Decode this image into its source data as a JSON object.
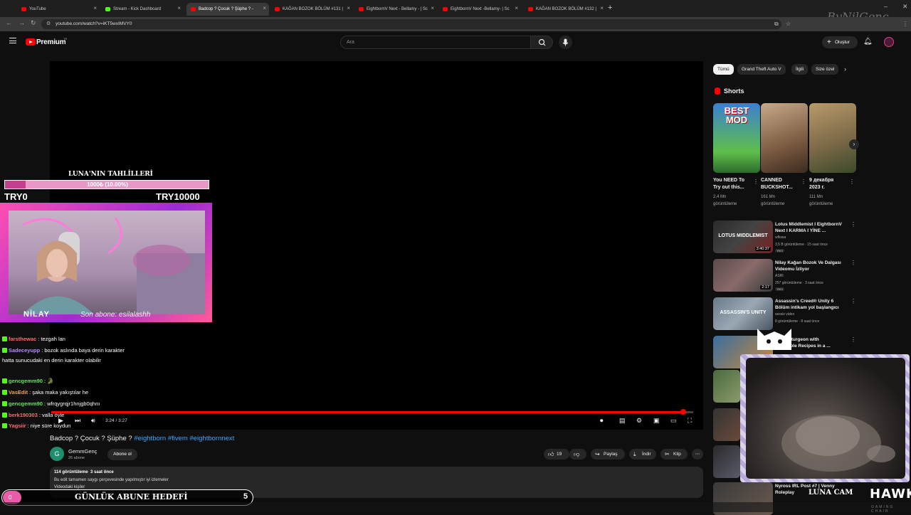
{
  "browser": {
    "tabs": [
      {
        "label": "YouTube",
        "color": "#ff0000",
        "active": false
      },
      {
        "label": "Stream - Kick Dashboard",
        "color": "#53fc18",
        "active": false
      },
      {
        "label": "Badcop ? Çocuk ? Şüphe ? -",
        "color": "#ff0000",
        "active": true
      },
      {
        "label": "KAĞAN BOZOK BÖLÜM #131 |",
        "color": "#ff0000",
        "active": false
      },
      {
        "label": "EightbornV Next - Bellamy - | Sc",
        "color": "#ff0000",
        "active": false
      },
      {
        "label": "EightbornV Next -Bellamy- | Sc",
        "color": "#ff0000",
        "active": false
      },
      {
        "label": "KAĞAN BOZOK BÖLÜM #132 |",
        "color": "#ff0000",
        "active": false
      }
    ],
    "url": "youtube.com/watch?v=iKT5wxIMVY0"
  },
  "header": {
    "brand": "Premium",
    "country": "TR",
    "search_placeholder": "Ara",
    "create_label": "Oluştur"
  },
  "player": {
    "time_current": "3:24",
    "time_total": "3:27",
    "progress": 0.985
  },
  "video": {
    "title": "Badcop ? Çocuk ? Şüphe ?",
    "hashtags": "#eightborn #fivem #eightbornnext",
    "channel": "GemmGenç",
    "channel_initial": "G",
    "subscribers": "26 abone",
    "subscribe_label": "Abone ol",
    "likes": "19",
    "share_label": "Paylaş",
    "download_label": "İndir",
    "clip_label": "Klip",
    "views": "114 görüntüleme",
    "age": "3 saat önce",
    "desc_line1": "Bu edit tamamen saygı çerçevesinde yapılmıştır iyi izlemeler",
    "desc_line2": "Videodaki kişiler"
  },
  "sidebar": {
    "chips": [
      "Tümü",
      "Grand Theft Auto V",
      "İlgili",
      "Size özel"
    ],
    "shorts_label": "Shorts",
    "shorts": [
      {
        "title1": "You NEED To",
        "title2": "Try out this...",
        "views1": "2,4 Mn",
        "views2": "görüntüleme",
        "thumb_text": "BEST MOD"
      },
      {
        "title1": "CANNED",
        "title2": "BUCKSHOT...",
        "views1": "161 Mn",
        "views2": "görüntüleme"
      },
      {
        "title1": "9 декабря",
        "title2": "2023 г.",
        "views1": "111 Mn",
        "views2": "görüntüleme"
      }
    ],
    "recommended": [
      {
        "title1": "Lotus Middlemist I EightbornV",
        "title2": "Next I KARMA I YİNE ...",
        "channel": "wflowa",
        "meta": "3,5 B görüntüleme · 15 saat önce",
        "badge": "Yeni",
        "duration": "3:40:37",
        "thumb_text": "LOTUS MIDDLEMIST"
      },
      {
        "title1": "Nilay Kağan Bozok Ve Dalgası",
        "title2": "Videomu İzliyor",
        "channel": "ASRI",
        "meta": "257 görüntüleme · 3 saat önce",
        "badge": "Yeni",
        "duration": "2:17"
      },
      {
        "title1": "Assassin's Creed® Unity 6",
        "title2": "Bölüm intikam yol başlangıcı",
        "channel": "sessiz video",
        "meta": "8 görüntüleme · 8 saat önce",
        "badge": "",
        "duration": "",
        "thumb_text": "ASSASSIN'S UNITY"
      },
      {
        "title1": "Giant Sturgeon with",
        "title2": "Incredible Recipes in a ...",
        "channel": "",
        "meta": "",
        "badge": "",
        "duration": ""
      },
      {
        "title1": "Nyross IRL Post #7 | Venny",
        "title2": "Roleplay",
        "channel": "",
        "meta": "",
        "badge": "",
        "duration": ""
      }
    ]
  },
  "overlay": {
    "goal_title": "LUNA'NIN TAHLİLLERİ",
    "goal_text": "1000₺ (10.00%)",
    "goal_progress": 0.1,
    "goal_min": "TRY0",
    "goal_max": "TRY10000",
    "cam_name": "NİLAY",
    "cam_sub": "Son abone: esilalashh",
    "daily_goal_label": "GÜNLÜK ABUNE HEDEFİ",
    "daily_goal_count": "5",
    "daily_goal_current": "0",
    "luna_cam": "LUNA CAM",
    "hawk": "HAWK",
    "hawk_sub": "GAMING CHAIR",
    "watermark": "ByNilGenç"
  },
  "chat": [
    {
      "user": "farsthewac",
      "color": "#ff6b6b",
      "msg": ": tezgah lan"
    },
    {
      "user": "Sadeceyupp",
      "color": "#b98cff",
      "msg": ": bozok aslında baya derin karakter hatta sunucudaki en derin karakter olabilir"
    },
    {
      "user": "gencgemm90",
      "color": "#5ee65e",
      "msg": ": 🐊"
    },
    {
      "user": "VasEdit",
      "color": "#ff9d3b",
      "msg": ": şaka maka yakıştılar he"
    },
    {
      "user": "gencgemm90",
      "color": "#5ee65e",
      "msg": ": wfrqygrqjr1hnjgb0qhnı"
    },
    {
      "user": "berk190303",
      "color": "#ff6b6b",
      "msg": ": valla öyle"
    },
    {
      "user": "Yagsiir",
      "color": "#ff6b6b",
      "msg": ": niye süre koydun"
    }
  ]
}
